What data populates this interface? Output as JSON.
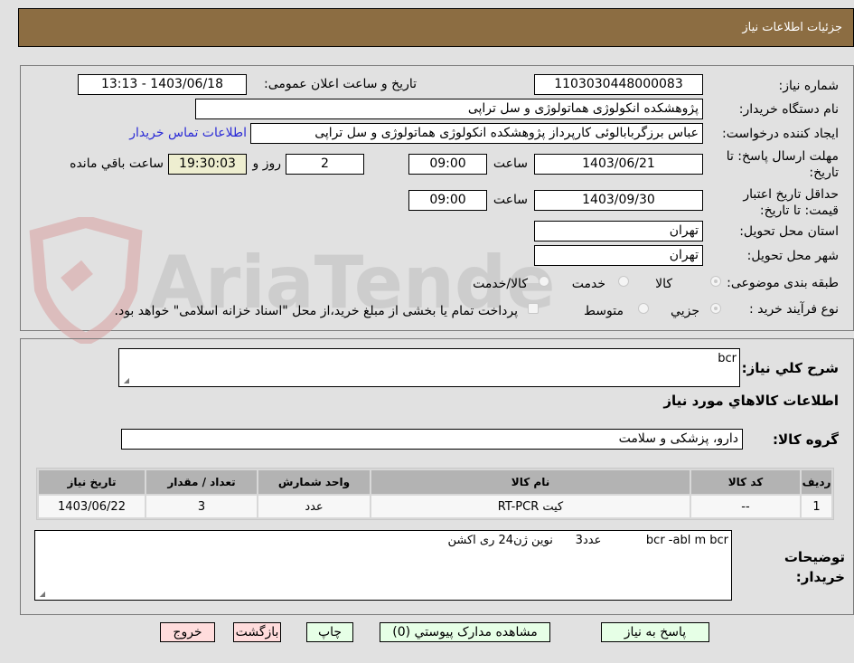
{
  "header": {
    "title": "جزئیات اطلاعات نیاز"
  },
  "details": {
    "need_number_label": "شماره نیاز:",
    "need_number": "1103030448000083",
    "announce_label": "تاریخ و ساعت اعلان عمومی:",
    "announce_value": "1403/06/18 - 13:13",
    "buyer_org_label": "نام دستگاه خریدار:",
    "buyer_org": "پژوهشکده انکولوژی هماتولوژی و سل تراپی",
    "creator_label": "ایجاد کننده درخواست:",
    "creator": "عباس برزگربابالوئی کارپرداز پژوهشکده انکولوژی هماتولوژی و سل تراپی",
    "contact_link": "اطلاعات تماس خریدار",
    "deadline_label": "مهلت ارسال پاسخ: تا تاریخ:",
    "deadline_date": "1403/06/21",
    "time_label": "ساعت",
    "deadline_time": "09:00",
    "days_remaining": "2",
    "days_and_label": "روز و",
    "time_remaining": "19:30:03",
    "time_remaining_label": "ساعت باقي مانده",
    "price_validity_label": "حداقل تاريخ اعتبار قیمت: تا تاریخ:",
    "price_validity_date": "1403/09/30",
    "price_validity_time": "09:00",
    "province_label": "استان محل تحویل:",
    "province": "تهران",
    "city_label": "شهر محل تحویل:",
    "city": "تهران",
    "category_label": "طبقه بندی موضوعی:",
    "category_options": [
      "کالا",
      "خدمت",
      "کالا/خدمت"
    ],
    "category_selected": "کالا",
    "process_label": "نوع فرآیند خرید :",
    "process_options": [
      "جزيي",
      "متوسط"
    ],
    "process_selected": "جزيي",
    "treasury_note": "پرداخت تمام یا بخشی از مبلغ خرید،از محل \"اسناد خزانه اسلامی\" خواهد بود."
  },
  "description": {
    "label": "شرح کلي نياز:",
    "value": "bcr",
    "goods_info_title": "اطلاعات کالاهاي مورد نياز",
    "group_label": "گروه کالا:",
    "group_value": "دارو، پزشکی و سلامت"
  },
  "table": {
    "headers": [
      "رديف",
      "کد کالا",
      "نام کالا",
      "واحد شمارش",
      "تعداد / مقدار",
      "تاریخ نیاز"
    ],
    "rows": [
      [
        "1",
        "--",
        "کیت RT-PCR",
        "عدد",
        "3",
        "1403/06/22"
      ]
    ]
  },
  "buyer_notes": {
    "label": "توضیحات خریدار:",
    "value": "bcr -abl m bcr            عدد3      نوین ژن24 ری اکشن"
  },
  "buttons": {
    "reply": "پاسخ به نیاز",
    "attachments": "مشاهده مدارک پیوستي (0)",
    "print": "چاپ",
    "back": "بازگشت",
    "exit": "خروج"
  },
  "watermark": {
    "text": "AriaTender.neT"
  },
  "colors": {
    "header_bg": "#8c6d42",
    "link": "#2b2bd6",
    "button_green": "#e6ffe6",
    "button_pink": "#ffdcdc",
    "countdown_bg": "#eeeed0"
  }
}
